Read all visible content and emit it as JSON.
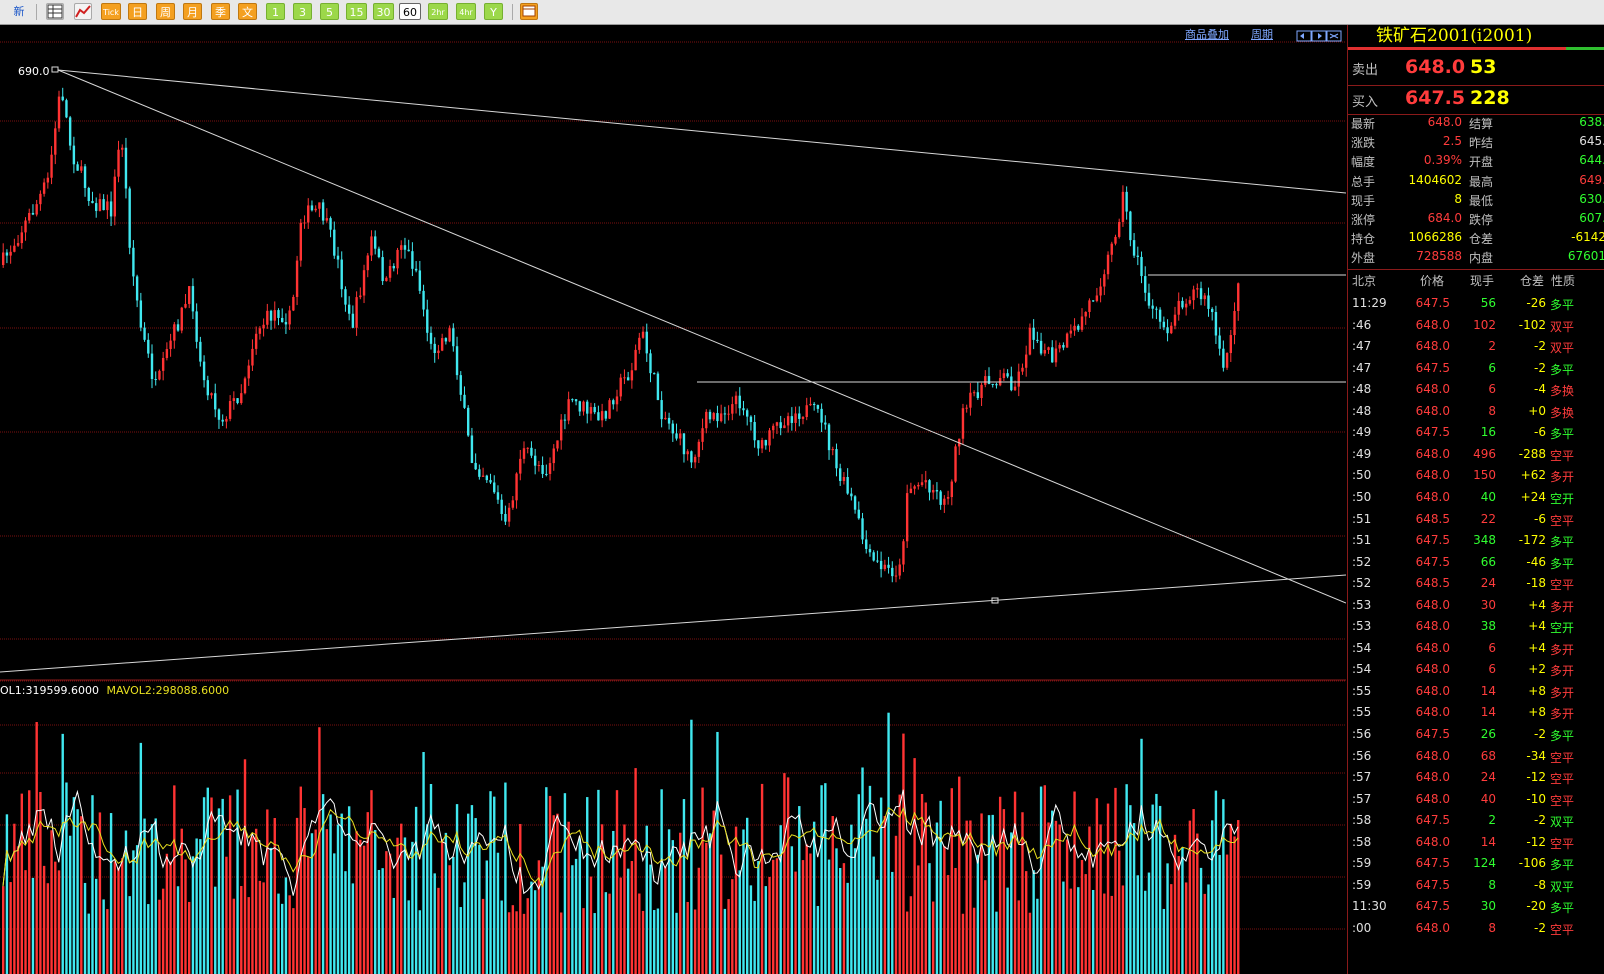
{
  "toolbar": {
    "items": [
      "新",
      "",
      "",
      "Tick",
      "日",
      "周",
      "月",
      "季",
      "文",
      "1",
      "3",
      "5",
      "15",
      "30",
      "60",
      "2hr",
      "4hr",
      "Y",
      ""
    ]
  },
  "chart_header": {
    "overlay": "商品叠加",
    "period": "周期"
  },
  "price_label": "690.0",
  "volume_legend": {
    "vol": "OL1:319599.6000",
    "mavol": "MAVOL2:298088.6000"
  },
  "title": "铁矿石2001(i2001)",
  "bid_ask": {
    "sell_label": "卖出",
    "sell_price": "648.0",
    "sell_qty": "53",
    "buy_label": "买入",
    "buy_price": "647.5",
    "buy_qty": "228"
  },
  "quote": [
    {
      "k1": "最新",
      "v1": "648.0",
      "c1": "red",
      "k2": "结算",
      "v2": "638.",
      "c2": "green"
    },
    {
      "k1": "涨跌",
      "v1": "2.5",
      "c1": "red",
      "k2": "昨结",
      "v2": "645.",
      "c2": "white"
    },
    {
      "k1": "幅度",
      "v1": "0.39%",
      "c1": "red",
      "k2": "开盘",
      "v2": "644.",
      "c2": "green"
    },
    {
      "k1": "总手",
      "v1": "1404602",
      "c1": "yellow",
      "k2": "最高",
      "v2": "649.",
      "c2": "red"
    },
    {
      "k1": "现手",
      "v1": "8",
      "c1": "yellow",
      "k2": "最低",
      "v2": "630.",
      "c2": "green"
    },
    {
      "k1": "涨停",
      "v1": "684.0",
      "c1": "red",
      "k2": "跌停",
      "v2": "607.",
      "c2": "green"
    },
    {
      "k1": "持仓",
      "v1": "1066286",
      "c1": "yellow",
      "k2": "仓差",
      "v2": "-6142",
      "c2": "yellow"
    },
    {
      "k1": "外盘",
      "v1": "728588",
      "c1": "red",
      "k2": "内盘",
      "v2": "67601",
      "c2": "green"
    }
  ],
  "ticks_header": {
    "time": "北京",
    "price": "价格",
    "qty": "现手",
    "oi": "仓差",
    "nature": "性质"
  },
  "ticks": [
    {
      "t": "11:29",
      "p": "647.5",
      "pc": "red",
      "q": "56",
      "qc": "green",
      "d": "-26",
      "dc": "yellow",
      "n": "多平",
      "nc": "green"
    },
    {
      "t": ":46",
      "p": "648.0",
      "pc": "red",
      "q": "102",
      "qc": "red",
      "d": "-102",
      "dc": "yellow",
      "n": "双平",
      "nc": "red"
    },
    {
      "t": ":47",
      "p": "648.0",
      "pc": "red",
      "q": "2",
      "qc": "red",
      "d": "-2",
      "dc": "yellow",
      "n": "双平",
      "nc": "red"
    },
    {
      "t": ":47",
      "p": "647.5",
      "pc": "red",
      "q": "6",
      "qc": "green",
      "d": "-2",
      "dc": "yellow",
      "n": "多平",
      "nc": "green"
    },
    {
      "t": ":48",
      "p": "648.0",
      "pc": "red",
      "q": "6",
      "qc": "red",
      "d": "-4",
      "dc": "yellow",
      "n": "多换",
      "nc": "red"
    },
    {
      "t": ":48",
      "p": "648.0",
      "pc": "red",
      "q": "8",
      "qc": "red",
      "d": "+0",
      "dc": "yellow",
      "n": "多换",
      "nc": "red"
    },
    {
      "t": ":49",
      "p": "647.5",
      "pc": "red",
      "q": "16",
      "qc": "green",
      "d": "-6",
      "dc": "yellow",
      "n": "多平",
      "nc": "green"
    },
    {
      "t": ":49",
      "p": "648.0",
      "pc": "red",
      "q": "496",
      "qc": "red",
      "d": "-288",
      "dc": "yellow",
      "n": "空平",
      "nc": "red"
    },
    {
      "t": ":50",
      "p": "648.0",
      "pc": "red",
      "q": "150",
      "qc": "red",
      "d": "+62",
      "dc": "yellow",
      "n": "多开",
      "nc": "red"
    },
    {
      "t": ":50",
      "p": "648.0",
      "pc": "red",
      "q": "40",
      "qc": "green",
      "d": "+24",
      "dc": "yellow",
      "n": "空开",
      "nc": "green"
    },
    {
      "t": ":51",
      "p": "648.5",
      "pc": "red",
      "q": "22",
      "qc": "red",
      "d": "-6",
      "dc": "yellow",
      "n": "空平",
      "nc": "red"
    },
    {
      "t": ":51",
      "p": "647.5",
      "pc": "red",
      "q": "348",
      "qc": "green",
      "d": "-172",
      "dc": "yellow",
      "n": "多平",
      "nc": "green"
    },
    {
      "t": ":52",
      "p": "647.5",
      "pc": "red",
      "q": "66",
      "qc": "green",
      "d": "-46",
      "dc": "yellow",
      "n": "多平",
      "nc": "green"
    },
    {
      "t": ":52",
      "p": "648.5",
      "pc": "red",
      "q": "24",
      "qc": "red",
      "d": "-18",
      "dc": "yellow",
      "n": "空平",
      "nc": "red"
    },
    {
      "t": ":53",
      "p": "648.0",
      "pc": "red",
      "q": "30",
      "qc": "red",
      "d": "+4",
      "dc": "yellow",
      "n": "多开",
      "nc": "red"
    },
    {
      "t": ":53",
      "p": "648.0",
      "pc": "red",
      "q": "38",
      "qc": "green",
      "d": "+4",
      "dc": "yellow",
      "n": "空开",
      "nc": "green"
    },
    {
      "t": ":54",
      "p": "648.0",
      "pc": "red",
      "q": "6",
      "qc": "red",
      "d": "+4",
      "dc": "yellow",
      "n": "多开",
      "nc": "red"
    },
    {
      "t": ":54",
      "p": "648.0",
      "pc": "red",
      "q": "6",
      "qc": "red",
      "d": "+2",
      "dc": "yellow",
      "n": "多开",
      "nc": "red"
    },
    {
      "t": ":55",
      "p": "648.0",
      "pc": "red",
      "q": "14",
      "qc": "red",
      "d": "+8",
      "dc": "yellow",
      "n": "多开",
      "nc": "red"
    },
    {
      "t": ":55",
      "p": "648.0",
      "pc": "red",
      "q": "14",
      "qc": "red",
      "d": "+8",
      "dc": "yellow",
      "n": "多开",
      "nc": "red"
    },
    {
      "t": ":56",
      "p": "647.5",
      "pc": "red",
      "q": "26",
      "qc": "green",
      "d": "-2",
      "dc": "yellow",
      "n": "多平",
      "nc": "green"
    },
    {
      "t": ":56",
      "p": "648.0",
      "pc": "red",
      "q": "68",
      "qc": "red",
      "d": "-34",
      "dc": "yellow",
      "n": "空平",
      "nc": "red"
    },
    {
      "t": ":57",
      "p": "648.0",
      "pc": "red",
      "q": "24",
      "qc": "red",
      "d": "-12",
      "dc": "yellow",
      "n": "空平",
      "nc": "red"
    },
    {
      "t": ":57",
      "p": "648.0",
      "pc": "red",
      "q": "40",
      "qc": "red",
      "d": "-10",
      "dc": "yellow",
      "n": "空平",
      "nc": "red"
    },
    {
      "t": ":58",
      "p": "647.5",
      "pc": "red",
      "q": "2",
      "qc": "green",
      "d": "-2",
      "dc": "yellow",
      "n": "双平",
      "nc": "green"
    },
    {
      "t": ":58",
      "p": "648.0",
      "pc": "red",
      "q": "14",
      "qc": "red",
      "d": "-12",
      "dc": "yellow",
      "n": "空平",
      "nc": "red"
    },
    {
      "t": ":59",
      "p": "647.5",
      "pc": "red",
      "q": "124",
      "qc": "green",
      "d": "-106",
      "dc": "yellow",
      "n": "多平",
      "nc": "green"
    },
    {
      "t": ":59",
      "p": "647.5",
      "pc": "red",
      "q": "8",
      "qc": "green",
      "d": "-8",
      "dc": "yellow",
      "n": "双平",
      "nc": "green"
    },
    {
      "t": "11:30",
      "p": "647.5",
      "pc": "red",
      "q": "30",
      "qc": "green",
      "d": "-20",
      "dc": "yellow",
      "n": "多平",
      "nc": "green"
    },
    {
      "t": ":00",
      "p": "648.0",
      "pc": "red",
      "q": "8",
      "qc": "red",
      "d": "-2",
      "dc": "yellow",
      "n": "空平",
      "nc": "red"
    }
  ],
  "colors": {
    "up": "#ff3333",
    "down": "#40e8f0",
    "grid": "#7a1010",
    "ma1": "#ffffff",
    "ma2": "#e8e020",
    "yellow": "#ffff00",
    "red": "#ff3c3c",
    "green": "#30ff30",
    "white": "#e0e0e0"
  }
}
